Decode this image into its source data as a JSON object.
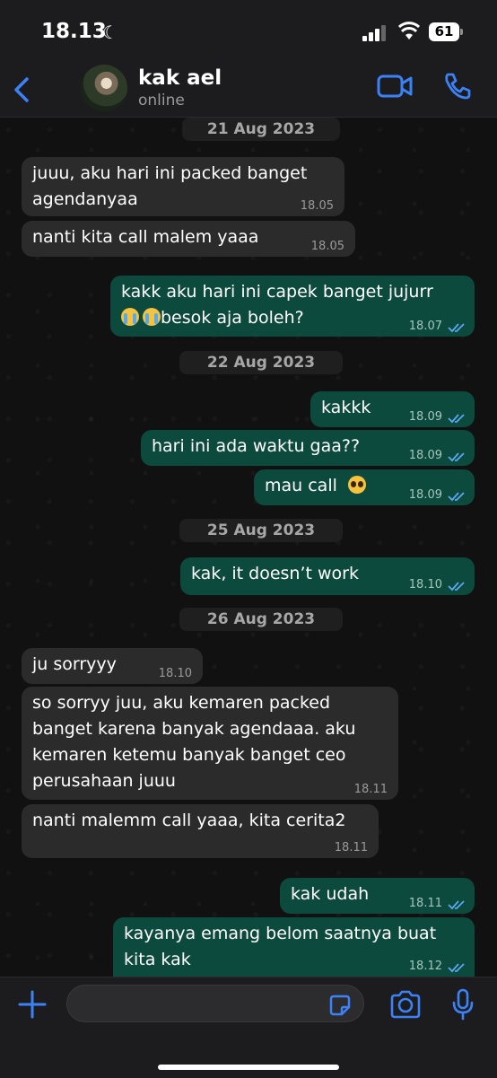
{
  "status_bar": {
    "time": "18.13",
    "battery": "61"
  },
  "contact": {
    "name": "kak ael",
    "presence": "online"
  },
  "input": {
    "placeholder": ""
  },
  "colors": {
    "accent": "#3b82f6",
    "outgoing_bubble": "#0d4a3e",
    "incoming_bubble": "#2b2b2b"
  },
  "icons": [
    "back-chevron-icon",
    "video-call-icon",
    "phone-call-icon",
    "plus-icon",
    "sticker-icon",
    "camera-icon",
    "microphone-icon",
    "double-check-icon"
  ],
  "dates": [
    "21 Aug 2023",
    "22 Aug 2023",
    "25 Aug 2023",
    "26 Aug 2023"
  ],
  "messages": [
    {
      "dir": "in",
      "lines": [
        "juuu, aku hari ini packed banget",
        "agendanyaa"
      ],
      "time": "18.05"
    },
    {
      "dir": "in",
      "lines": [
        "nanti kita call malem yaaa"
      ],
      "time": "18.05"
    },
    {
      "dir": "out",
      "lines": [
        "kakk aku hari ini capek banget jujurr",
        "besok aja boleh?"
      ],
      "time": "18.07",
      "read": true
    },
    {
      "dir": "out",
      "lines": [
        "kakkk"
      ],
      "time": "18.09",
      "read": true
    },
    {
      "dir": "out",
      "lines": [
        "hari ini ada waktu gaa??"
      ],
      "time": "18.09",
      "read": true
    },
    {
      "dir": "out",
      "lines": [
        "mau call"
      ],
      "time": "18.09",
      "read": true
    },
    {
      "dir": "out",
      "lines": [
        "kak, it doesn’t work"
      ],
      "time": "18.10",
      "read": true
    },
    {
      "dir": "in",
      "lines": [
        "ju sorryyy"
      ],
      "time": "18.10"
    },
    {
      "dir": "in",
      "lines": [
        "so sorryy juu, aku kemaren packed",
        "banget karena banyak agendaaa. aku",
        "kemaren ketemu banyak banget ceo",
        "perusahaan juuu"
      ],
      "time": "18.11"
    },
    {
      "dir": "in",
      "lines": [
        "nanti malemm call yaaa, kita cerita2"
      ],
      "time": "18.11"
    },
    {
      "dir": "out",
      "lines": [
        "kak udah"
      ],
      "time": "18.11",
      "read": true
    },
    {
      "dir": "out",
      "lines": [
        "kayanya emang belom saatnya buat",
        "kita kak"
      ],
      "time": "18.12",
      "read": true
    }
  ]
}
